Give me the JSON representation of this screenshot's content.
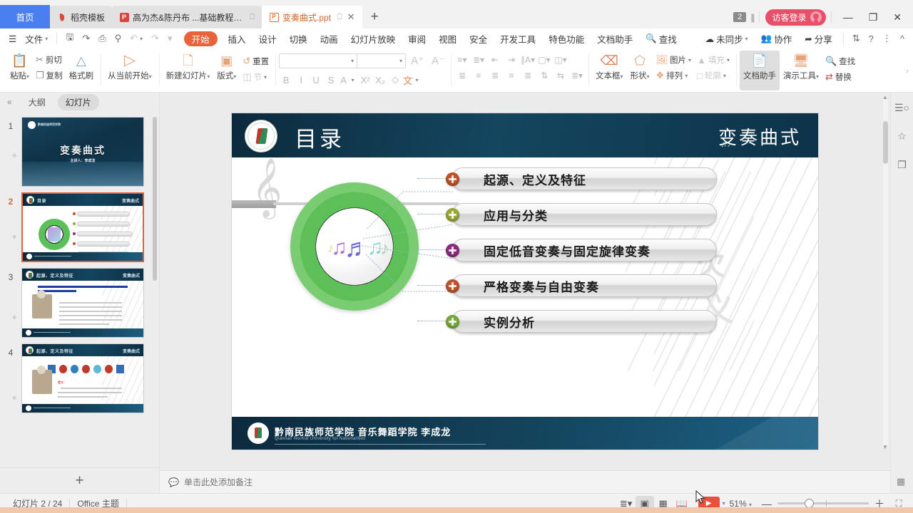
{
  "window": {
    "tabs": [
      {
        "label": "首页",
        "type": "home",
        "icon": "home-icon"
      },
      {
        "label": "稻壳模板",
        "type": "inactive",
        "icon": "wps-docer-icon"
      },
      {
        "label": "高为杰&陈丹布 ...基础教程.pdf",
        "type": "inactive",
        "icon": "pdf-icon",
        "has_monitor": true
      },
      {
        "label": "变奏曲式.ppt",
        "type": "active",
        "icon": "ppt-icon",
        "has_monitor": true,
        "has_close": true
      }
    ],
    "new_tab_label": "+",
    "tab_count_badge": "2",
    "login_label": "访客登录",
    "minimize": "—",
    "restore": "❐",
    "close": "✕"
  },
  "menubar": {
    "file_label": "文件",
    "quick_icons": [
      "save-icon",
      "save-as-icon",
      "print-icon",
      "print-preview-icon",
      "undo-icon",
      "redo-icon",
      "customize-icon"
    ],
    "tabs": [
      {
        "label": "开始",
        "active": true
      },
      {
        "label": "插入",
        "active": false
      },
      {
        "label": "设计",
        "active": false
      },
      {
        "label": "切换",
        "active": false
      },
      {
        "label": "动画",
        "active": false
      },
      {
        "label": "幻灯片放映",
        "active": false
      },
      {
        "label": "审阅",
        "active": false
      },
      {
        "label": "视图",
        "active": false
      },
      {
        "label": "安全",
        "active": false
      },
      {
        "label": "开发工具",
        "active": false
      },
      {
        "label": "特色功能",
        "active": false
      },
      {
        "label": "文档助手",
        "active": false
      }
    ],
    "find_label": "查找",
    "sync_label": "未同步",
    "collab_label": "协作",
    "share_label": "分享",
    "backup_icon": "backup-icon",
    "help_icon": "help-icon",
    "more_icon": "more-icon",
    "collapse_icon": "collapse-ribbon-icon"
  },
  "ribbon": {
    "clipboard": {
      "paste": "粘贴",
      "cut": "剪切",
      "copy": "复制",
      "format_painter": "格式刷"
    },
    "start_show": "从当前开始",
    "slides": {
      "new_slide": "新建幻灯片",
      "layout": "版式",
      "section": "节",
      "reset": "重置"
    },
    "font": {
      "name_value": "",
      "name_placeholder": "",
      "size_value": "",
      "size_placeholder": "",
      "grow": "A⁺",
      "shrink": "A⁻",
      "bold": "B",
      "italic": "I",
      "underline": "U",
      "strike": "S",
      "font_color": "A",
      "superscript": "X²",
      "subscript": "X₂",
      "clear_format": "◇",
      "phonetic": "文"
    },
    "insert": {
      "textbox": "文本框",
      "shape": "形状",
      "picture": "图片",
      "arrange": "排列",
      "fill": "填充",
      "outline": "轮廓"
    },
    "tools": {
      "doc_assistant": "文档助手",
      "present_tools": "演示工具",
      "find": "查找",
      "replace": "替换"
    }
  },
  "left_panel": {
    "collapse_icon": "collapse-panel-icon",
    "tab_outline": "大纲",
    "tab_slides": "幻灯片",
    "add_slide_label": "+",
    "slides": [
      {
        "num": "1",
        "selected": false,
        "kind": "cover",
        "title": "变奏曲式",
        "subtitle": "主讲人：李成龙"
      },
      {
        "num": "2",
        "selected": true,
        "kind": "toc",
        "title": "目录",
        "corner": "变奏曲式"
      },
      {
        "num": "3",
        "selected": false,
        "kind": "text",
        "title": "起源、定义及特征",
        "corner": "变奏曲式"
      },
      {
        "num": "4",
        "selected": false,
        "kind": "chevrons",
        "title": "起源、定义及特征",
        "corner": "变奏曲式"
      }
    ]
  },
  "slide": {
    "title": "目录",
    "corner_title": "变奏曲式",
    "items": [
      {
        "text": "起源、定义及特征",
        "bullet_color": "#c0522a"
      },
      {
        "text": "应用与分类",
        "bullet_color": "#9aa832"
      },
      {
        "text": "固定低音变奏与固定旋律变奏",
        "bullet_color": "#8e2a7e"
      },
      {
        "text": "严格变奏与自由变奏",
        "bullet_color": "#c0522a"
      },
      {
        "text": "实例分析",
        "bullet_color": "#7aa83c"
      }
    ],
    "footer_org": "黔南民族师范学院 音乐舞蹈学院   李成龙",
    "footer_org_en": "Qiannan Normal University for Nationalities",
    "center_image": "music-notes-image"
  },
  "notes": {
    "icon": "notes-icon",
    "placeholder": "单击此处添加备注"
  },
  "right_rail": {
    "icons": [
      "properties-icon",
      "animation-icon",
      "clipboard-panel-icon"
    ]
  },
  "statusbar": {
    "slide_counter": "幻灯片 2 / 24",
    "theme": "Office 主题",
    "view_buttons": [
      "outline-view-icon",
      "normal-view-icon",
      "slide-sorter-icon",
      "reading-view-icon"
    ],
    "play_label": "▶",
    "zoom_label": "51%",
    "zoom_minus": "—",
    "zoom_plus": "＋",
    "fit_icon": "fit-to-window-icon",
    "grid_icon": "grid-icon"
  },
  "colors": {
    "accent": "#e8633a",
    "tab_home_blue": "#4a7ff0",
    "login_red": "#e8506a",
    "slide_header_dark": "#14465f",
    "selection_orange": "#e0613a"
  }
}
